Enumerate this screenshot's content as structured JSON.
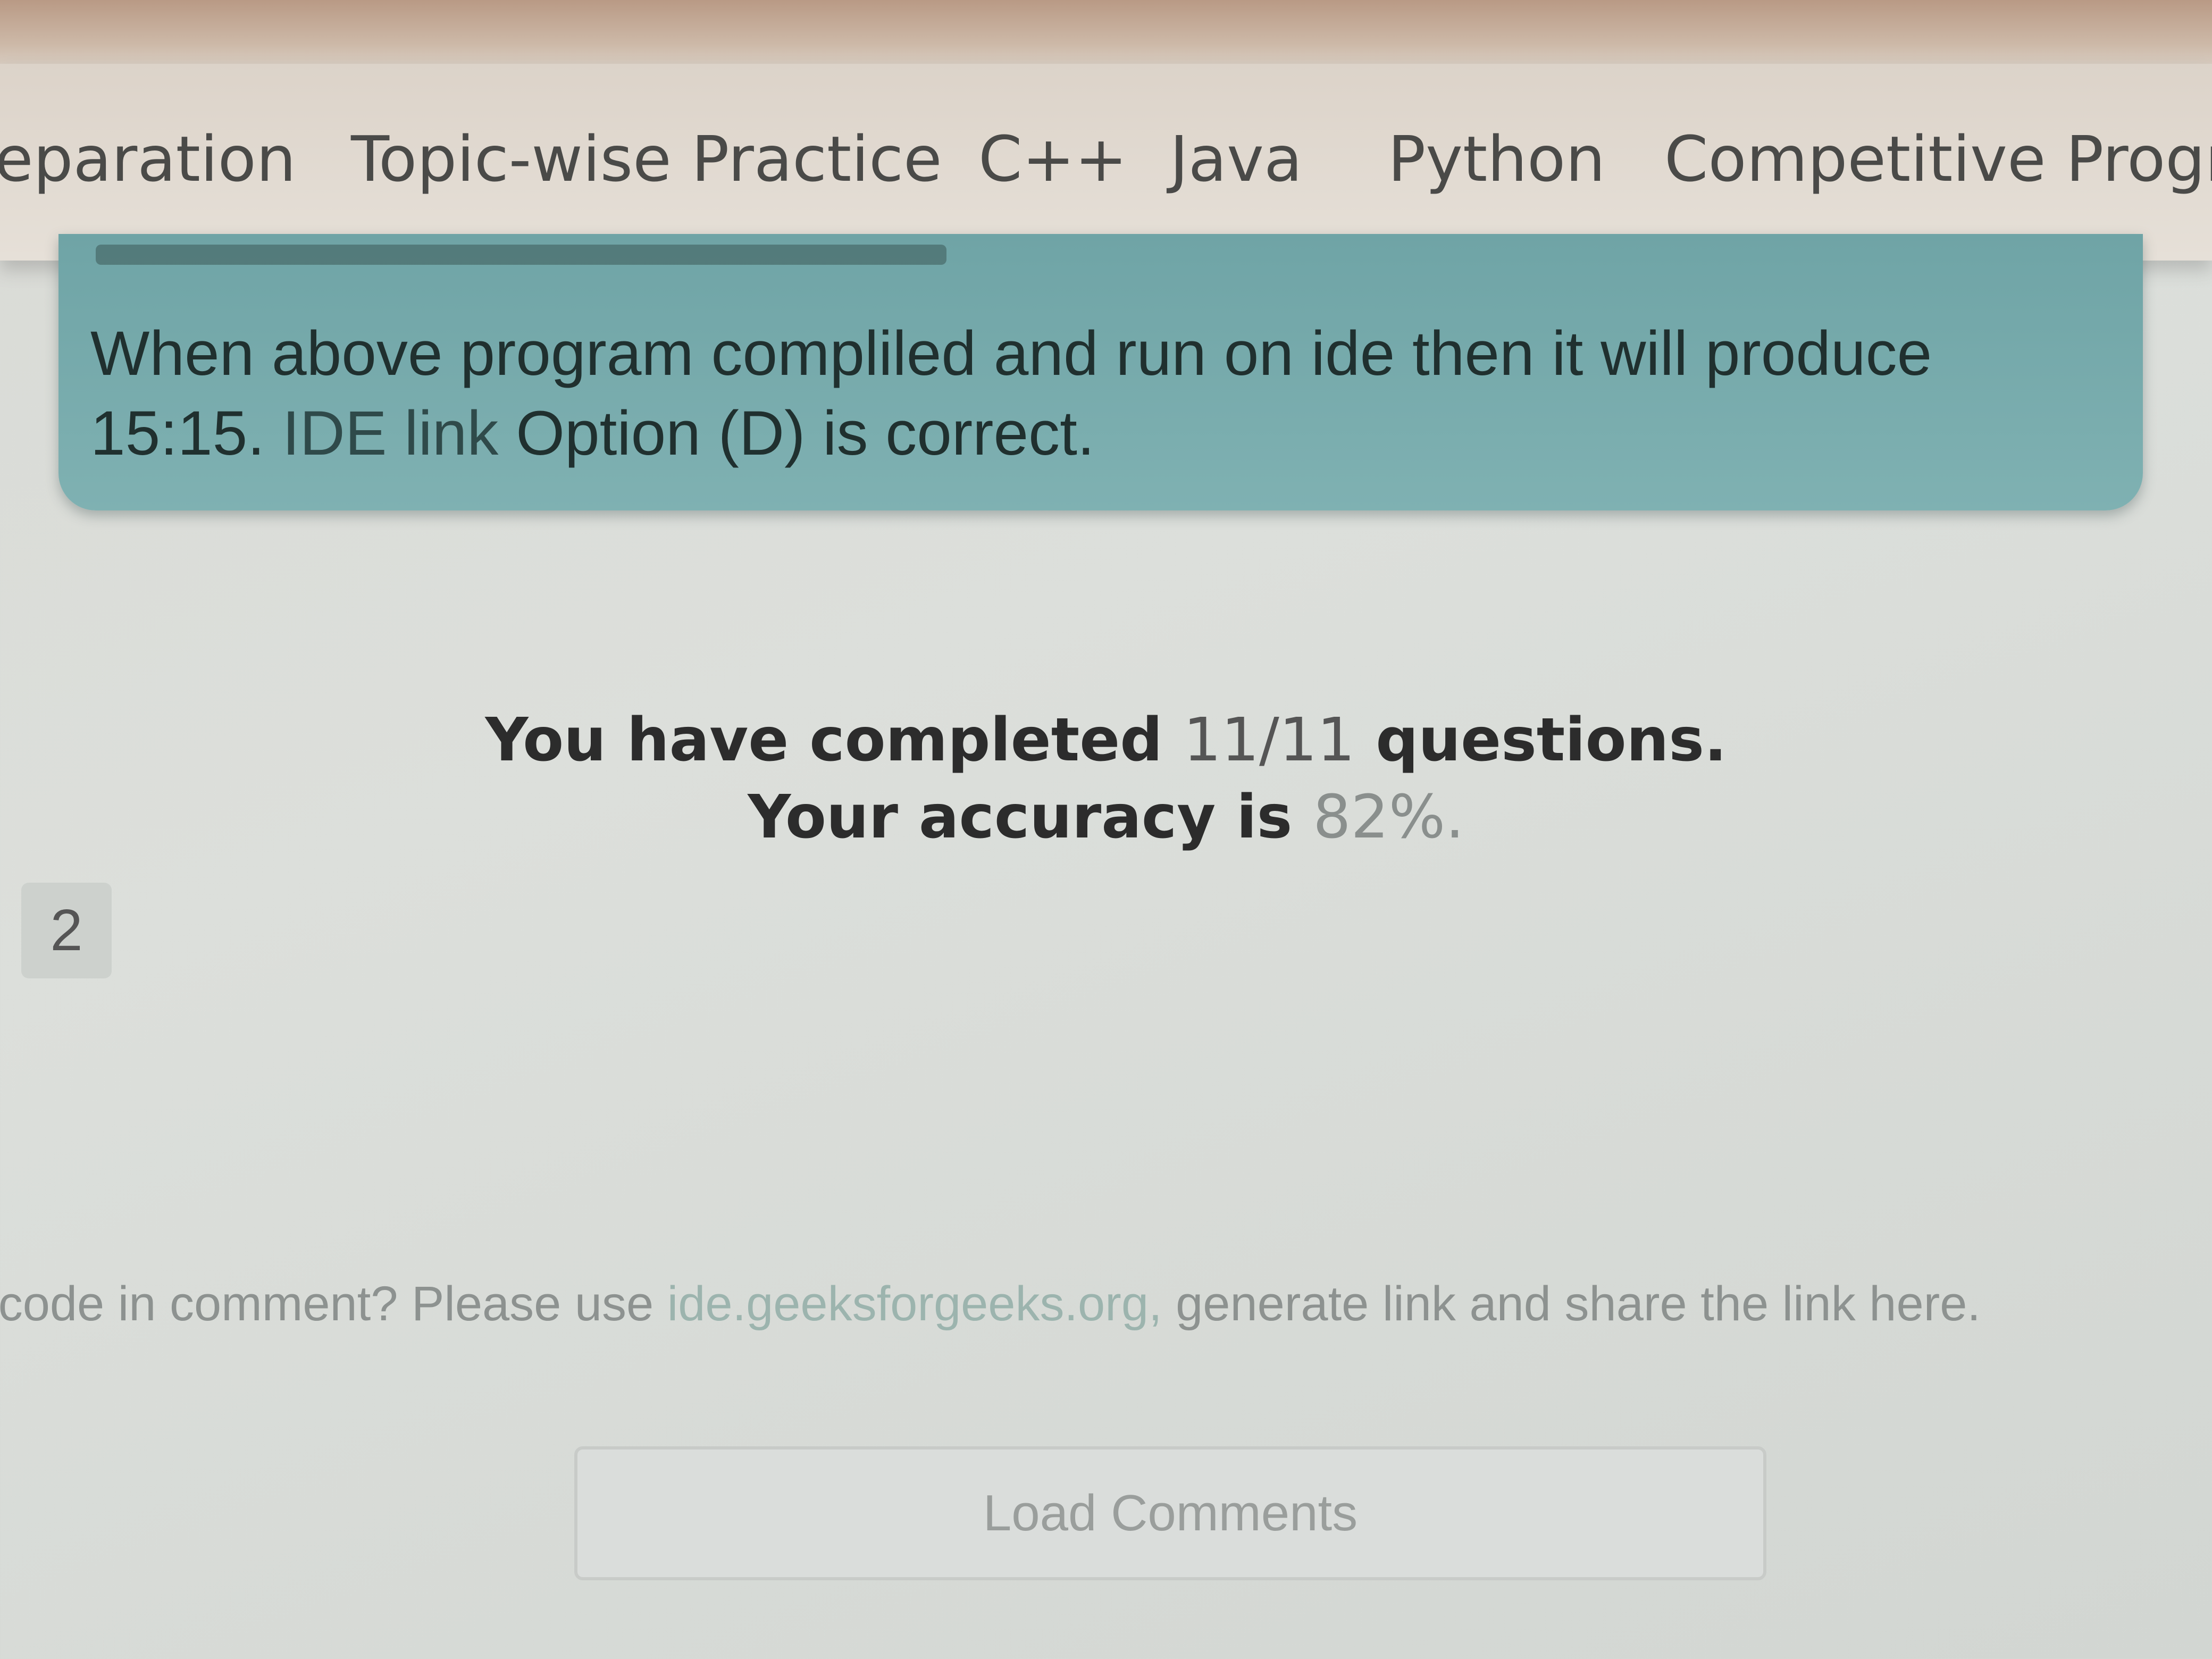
{
  "nav": {
    "items": [
      "eparation",
      "Topic-wise Practice",
      "C++",
      "Java",
      "Python",
      "Competitive Progra"
    ]
  },
  "explanation": {
    "text_before_link": "When above program compliled and run on ide then it will produce 15:15. ",
    "link_text": "IDE link",
    "text_after_link": " Option (D) is correct."
  },
  "summary": {
    "line1_prefix": "You have completed ",
    "completed": "11/11",
    "line1_suffix": " questions.",
    "line2_prefix": "Your accuracy is ",
    "accuracy": "82%",
    "line2_suffix": "."
  },
  "pagination": {
    "page": "2"
  },
  "comments": {
    "hint_prefix": "g code in comment? Please use ",
    "hint_link": "ide.geeksforgeeks.org,",
    "hint_suffix": " generate link and share the link here.",
    "load_button": "Load Comments"
  }
}
